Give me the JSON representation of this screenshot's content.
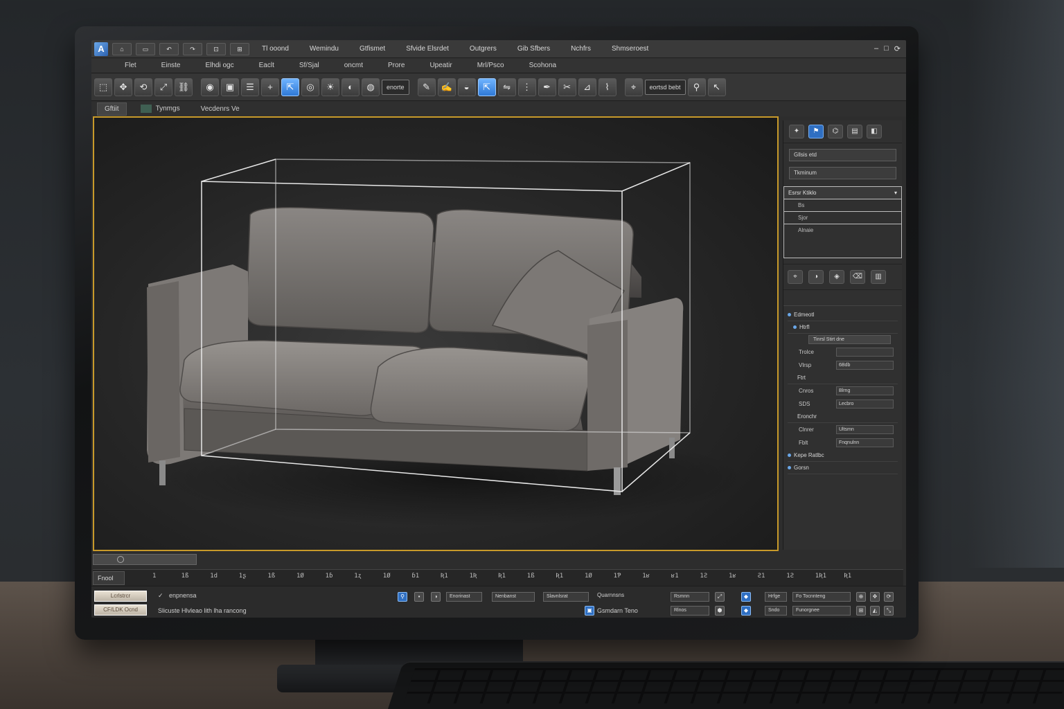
{
  "app": {
    "logo_letter": "A",
    "window_controls": [
      "–",
      "□",
      "⟳"
    ]
  },
  "quick_access": [
    "⌂",
    "▭",
    "↶",
    "↷",
    "⊡",
    "⊞"
  ],
  "menubar_top": [
    "Tl ooond",
    "Wemindu",
    "Gtfismet",
    "Sfvide Elsrdet",
    "Outgrers",
    "Gib Sfbers",
    "Nchfrs",
    "Shmseroest"
  ],
  "menubar_main": [
    "Flet",
    "Einste",
    "Elhdi ogc",
    "Eaclt",
    "Sf/Sjal",
    "oncmt",
    "Prore",
    "Upeatir",
    "Mrl/Psco",
    "Scohona"
  ],
  "toolbar": {
    "field_a": "enorte",
    "field_b": "eortsd bebt"
  },
  "tabs": [
    "Gftiit",
    "Tynmgs",
    "Vecdenrs Ve"
  ],
  "right_panel": {
    "field_1": "Gllsis etd",
    "field_2": "Tkminum",
    "list_selected": "Esrsr Ktiklo",
    "list_rows": [
      "Bs",
      "Sjor",
      "Alnaie"
    ],
    "groups": [
      {
        "label": "Edmeotl",
        "expanded": true
      },
      {
        "label": "Htrfl",
        "expanded": true
      }
    ],
    "wide_field": "Tinrsl Stirt dne",
    "props_a": [
      {
        "label": "Trolce",
        "value": ""
      },
      {
        "label": "Vlrsp",
        "value": "6Bdb"
      }
    ],
    "group_b": "Ftrt",
    "props_b": [
      {
        "label": "Cnros",
        "value": "Blrng"
      },
      {
        "label": "SDS",
        "value": "Lecbro"
      }
    ],
    "group_c": "Eronchr",
    "props_c": [
      {
        "label": "Clnrer",
        "value": "Ultsmn"
      },
      {
        "label": "Fblt",
        "value": "Fnqnulnn"
      }
    ],
    "footer_groups": [
      "Kepe Ratlbc",
      "Gorsn"
    ]
  },
  "timeline": {
    "label": "Fnool",
    "ticks": [
      "1",
      "1ß",
      "1d",
      "1ʂ",
      "1ß",
      "1Ø",
      "1ɓ",
      "1ʐ",
      "1Ø",
      "ɓ1",
      "Ʀ1",
      "1Ʀ",
      "Ʀ1",
      "1ß",
      "Ʀ1",
      "1Ø",
      "1Ƥ",
      "1ʁ",
      "ʁ1",
      "1Ƨ",
      "1ʁ",
      "Ƨ1",
      "1Ƨ",
      "1Ʀ1",
      "Ʀ1"
    ]
  },
  "statusbar": {
    "btn_1": "Lcrlstrcr",
    "btn_2": "CF/LDK Ocnd",
    "cmd_line": "enpnensa",
    "prompt": "Slicuste Hlvleao lith lha rancong",
    "field_a": "Enorinast",
    "field_b": "Nenbanst",
    "field_c": "Slavnlsrat",
    "label_d": "Quarnnsns",
    "status_text": "Gsmdarn Teno",
    "field_e": "Rsmnn",
    "field_f": "Rlnos",
    "field_g": "Hrfge",
    "field_h": "Fo Tocnnteng",
    "field_i": "Sndo",
    "field_j": "Funorgnee"
  },
  "colors": {
    "viewport_border": "#c89a2a",
    "accent_blue": "#2f79d6",
    "bounding_box": "#e8e8e8"
  }
}
